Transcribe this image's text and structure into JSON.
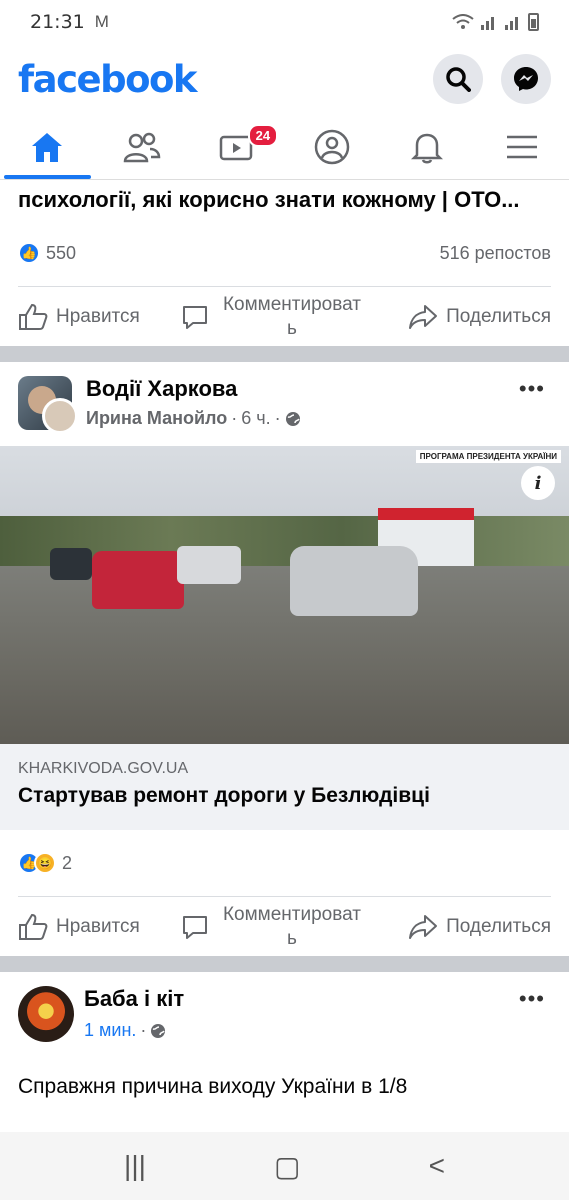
{
  "status_bar": {
    "time": "21:31",
    "notification_icon": "gmail-icon",
    "right_icons": [
      "wifi-icon",
      "signal-icon",
      "signal-icon",
      "battery-icon"
    ]
  },
  "header": {
    "logo": "facebook",
    "search_icon": "search-icon",
    "messenger_icon": "messenger-icon"
  },
  "nav": {
    "items": [
      {
        "name": "home",
        "icon": "home-icon",
        "active": true
      },
      {
        "name": "friends",
        "icon": "friends-icon"
      },
      {
        "name": "watch",
        "icon": "watch-icon",
        "badge": "24"
      },
      {
        "name": "profile",
        "icon": "profile-icon"
      },
      {
        "name": "notifications",
        "icon": "bell-icon"
      },
      {
        "name": "menu",
        "icon": "hamburger-icon"
      }
    ]
  },
  "post0": {
    "title_fragment": "психології, які корисно знати кожному | ОТО...",
    "likes": "550",
    "shares": "516 репостов"
  },
  "actions": {
    "like": "Нравится",
    "comment_line1": "Комментироват",
    "comment_line2": "ь",
    "share": "Поделиться"
  },
  "post1": {
    "page_name": "Водії Харкова",
    "author": "Ирина Манойло",
    "time": "6 ч.",
    "privacy_icon": "globe-icon",
    "image_banner": "ПРОГРАМА ПРЕЗИДЕНТА УКРАЇНИ",
    "image_info": "i",
    "link_domain": "KHARKIVODA.GOV.UA",
    "link_title": "Стартував ремонт дороги у Безлюдівці",
    "reactions_count": "2"
  },
  "post2": {
    "page_name": "Баба і кіт",
    "time": "1 мин.",
    "text": "Справжня причина виходу України в 1/8"
  },
  "colors": {
    "brand": "#1877f2",
    "badge": "#e41e3f",
    "separator": "#c9ccd1"
  }
}
